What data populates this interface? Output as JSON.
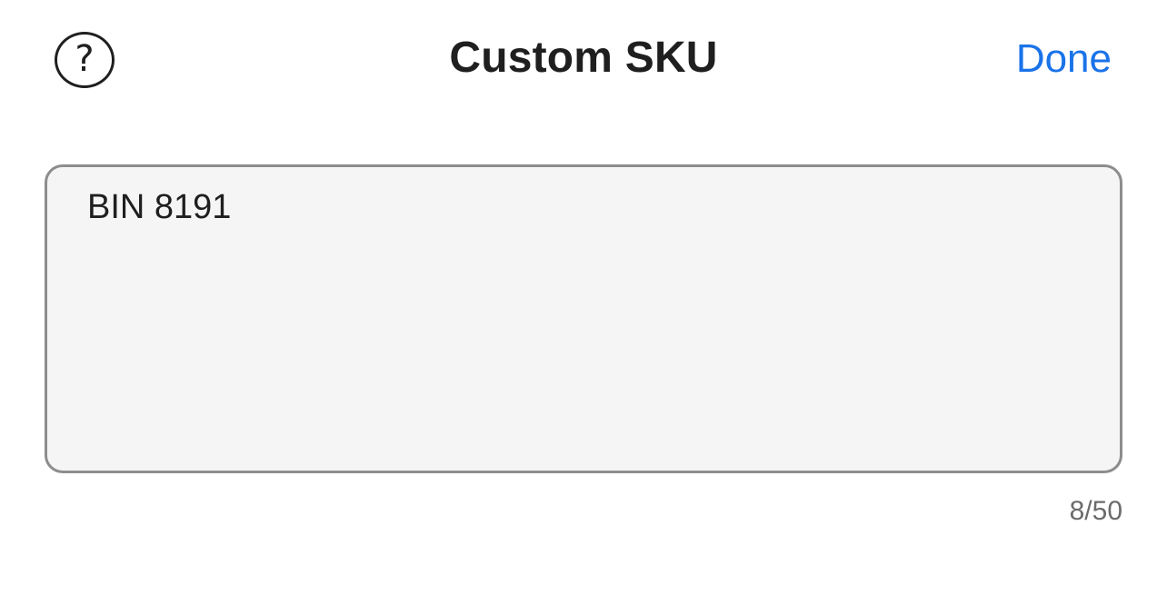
{
  "header": {
    "title": "Custom SKU",
    "help_label": "?",
    "done_label": "Done"
  },
  "sku_field": {
    "value": "BIN 8191",
    "counter": "8/50"
  },
  "colors": {
    "accent": "#1a73e8",
    "text": "#1f1f1f",
    "field_background": "#f5f5f5",
    "field_border": "#8d8d8d",
    "counter_text": "#6b6b6b"
  },
  "icons": {
    "help": "question-circle-icon"
  }
}
